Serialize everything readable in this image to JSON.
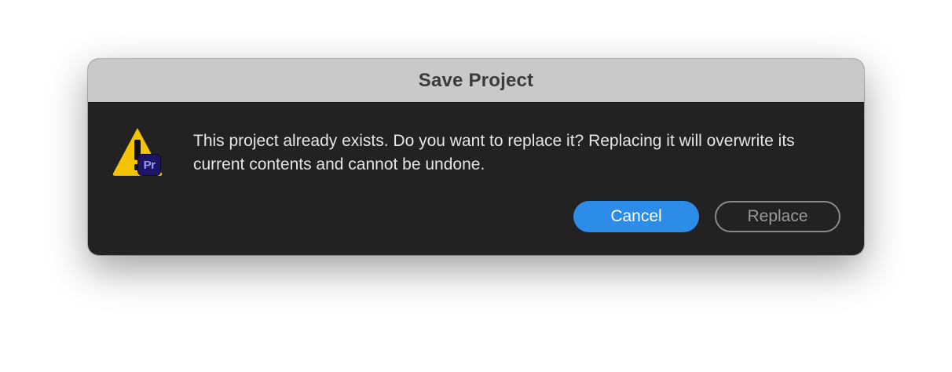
{
  "dialog": {
    "title": "Save Project",
    "message": "This project already exists. Do you want to replace it? Replacing it will overwrite its current contents and cannot be undone.",
    "icon": "warning-icon",
    "badge_icon": "premiere-pro-icon",
    "badge_text": "Pr"
  },
  "buttons": {
    "cancel_label": "Cancel",
    "replace_label": "Replace"
  },
  "colors": {
    "titlebar": "#c9c9c9",
    "body": "#222222",
    "warning": "#f5c400",
    "premiere_badge": "#1b1563",
    "premiere_text": "#9999ff",
    "primary_button": "#2c8ce8"
  }
}
